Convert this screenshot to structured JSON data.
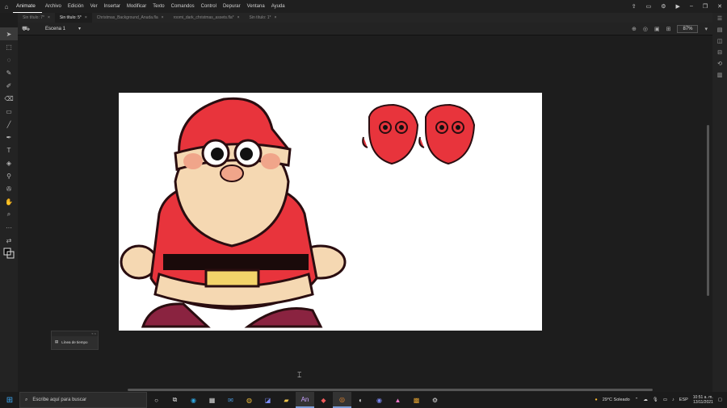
{
  "app": {
    "name": "Animate"
  },
  "menu": [
    "Archivo",
    "Edición",
    "Ver",
    "Insertar",
    "Modificar",
    "Texto",
    "Comandos",
    "Control",
    "Depurar",
    "Ventana",
    "Ayuda"
  ],
  "tabs": [
    {
      "label": "Sin título: 7*",
      "active": false
    },
    {
      "label": "Sin título: 5*",
      "active": true
    },
    {
      "label": "Christmas_Background_Anuda.fla",
      "active": false
    },
    {
      "label": "roomi_dark_christmas_assets.fla*",
      "active": false
    },
    {
      "label": "Sin título: 1*",
      "active": false
    }
  ],
  "editbar": {
    "scene_label": "Escena 1",
    "zoom": "87%"
  },
  "timeline_panel": {
    "label": "Línea de tiempo"
  },
  "taskbar": {
    "search_placeholder": "Escribe aquí para buscar",
    "weather": "29°C  Soleado",
    "language": "ESP",
    "time": "10:51 a. m.",
    "date": "13/11/2021",
    "icons": [
      "cortana-icon",
      "task-view-icon",
      "edge-icon",
      "store-icon",
      "mail-icon",
      "chrome-icon",
      "app-icon",
      "explorer-icon",
      "animate-icon",
      "app2-icon",
      "app3-icon",
      "discord-icon",
      "app4-icon",
      "app5-icon",
      "app6-icon"
    ]
  },
  "colors": {
    "accent": "#3da9f5",
    "santa_red": "#e8343c",
    "stage": "#ffffff"
  }
}
